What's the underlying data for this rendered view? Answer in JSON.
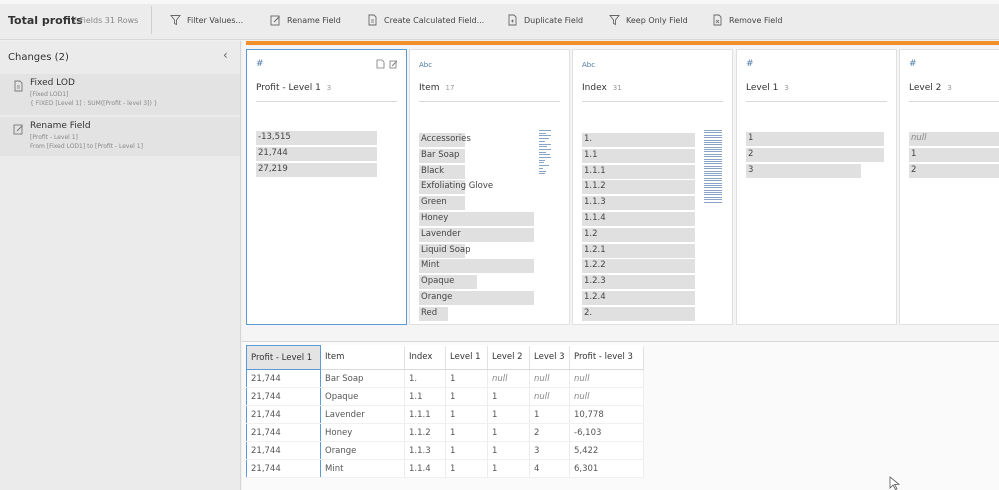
{
  "toolbar": {
    "title": "Total profits",
    "meta": "7 Fields  31 Rows",
    "filter_label": "Filter Values...",
    "rename_label": "Rename Field",
    "calc_label": "Create Calculated Field...",
    "duplicate_label": "Duplicate Field",
    "keep_label": "Keep Only Field",
    "remove_label": "Remove Field"
  },
  "changes": {
    "title": "Changes (2)",
    "items": [
      {
        "title": "Fixed LOD",
        "line1": "[Fixed LOD1]",
        "line2": "{ FIXED [Level 1] : SUM([Profit - level 3]) }",
        "icon": "calculated-field-icon"
      },
      {
        "title": "Rename Field",
        "line1": "[Profit - Level 1]",
        "line2": "From [Fixed LOD1] to [Profit - Level 1]",
        "icon": "rename-icon"
      }
    ]
  },
  "cards": [
    {
      "type": "#",
      "name": "Profit - Level 1",
      "count": "3",
      "values": [
        {
          "label": "-13,515",
          "fill": 1.0
        },
        {
          "label": "21,744",
          "fill": 1.0
        },
        {
          "label": "27,219",
          "fill": 1.0
        }
      ]
    },
    {
      "type": "Abc",
      "name": "Item",
      "count": "17",
      "values": [
        {
          "label": "Accessories",
          "fill": 0.4
        },
        {
          "label": "Bar Soap",
          "fill": 0.4
        },
        {
          "label": "Black",
          "fill": 0.4
        },
        {
          "label": "Exfoliating Glove",
          "fill": 0.4
        },
        {
          "label": "Green",
          "fill": 0.4
        },
        {
          "label": "Honey",
          "fill": 1.0
        },
        {
          "label": "Lavender",
          "fill": 1.0
        },
        {
          "label": "Liquid Soap",
          "fill": 0.4
        },
        {
          "label": "Mint",
          "fill": 1.0
        },
        {
          "label": "Opaque",
          "fill": 0.5
        },
        {
          "label": "Orange",
          "fill": 1.0
        },
        {
          "label": "Red",
          "fill": 0.25
        }
      ]
    },
    {
      "type": "Abc",
      "name": "Index",
      "count": "31",
      "values": [
        {
          "label": "1.",
          "fill": 1.0
        },
        {
          "label": "1.1",
          "fill": 1.0
        },
        {
          "label": "1.1.1",
          "fill": 1.0
        },
        {
          "label": "1.1.2",
          "fill": 1.0
        },
        {
          "label": "1.1.3",
          "fill": 1.0
        },
        {
          "label": "1.1.4",
          "fill": 1.0
        },
        {
          "label": "1.2",
          "fill": 1.0
        },
        {
          "label": "1.2.1",
          "fill": 1.0
        },
        {
          "label": "1.2.2",
          "fill": 1.0
        },
        {
          "label": "1.2.3",
          "fill": 1.0
        },
        {
          "label": "1.2.4",
          "fill": 1.0
        },
        {
          "label": "2.",
          "fill": 1.0
        }
      ]
    },
    {
      "type": "#",
      "name": "Level 1",
      "count": "3",
      "values": [
        {
          "label": "1",
          "fill": 1.0
        },
        {
          "label": "2",
          "fill": 1.0
        },
        {
          "label": "3",
          "fill": 0.83
        }
      ]
    },
    {
      "type": "#",
      "name": "Level 2",
      "count": "3",
      "values": [
        {
          "label": "null",
          "fill": 1.0,
          "italic": true
        },
        {
          "label": "1",
          "fill": 1.0
        },
        {
          "label": "2",
          "fill": 1.0
        }
      ]
    }
  ],
  "grid": {
    "columns": [
      "Profit - Level 1",
      "Item",
      "Index",
      "Level 1",
      "Level 2",
      "Level 3",
      "Profit - level 3"
    ],
    "rows": [
      [
        "21,744",
        "Bar Soap",
        "1.",
        "1",
        "null",
        "null",
        "null"
      ],
      [
        "21,744",
        "Opaque",
        "1.1",
        "1",
        "1",
        "null",
        "null"
      ],
      [
        "21,744",
        "Lavender",
        "1.1.1",
        "1",
        "1",
        "1",
        "10,778"
      ],
      [
        "21,744",
        "Honey",
        "1.1.2",
        "1",
        "1",
        "2",
        "-6,103"
      ],
      [
        "21,744",
        "Orange",
        "1.1.3",
        "1",
        "1",
        "3",
        "5,422"
      ],
      [
        "21,744",
        "Mint",
        "1.1.4",
        "1",
        "1",
        "4",
        "6,301"
      ]
    ]
  },
  "colors": {
    "accent": "#f28e2b",
    "selection": "#5b9bd5",
    "type_icon": "#4e79a7"
  }
}
